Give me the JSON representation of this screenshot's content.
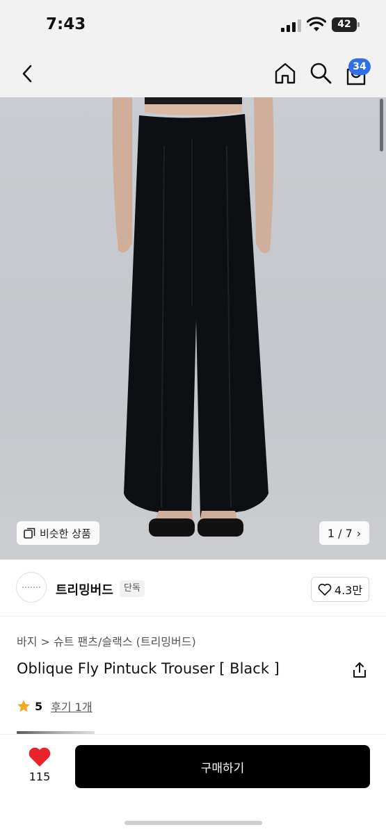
{
  "status_bar": {
    "time": "7:43",
    "battery": "42"
  },
  "nav": {
    "cart_count": "34",
    "icons": [
      "back-icon",
      "home-icon",
      "search-icon",
      "cart-icon"
    ]
  },
  "gallery": {
    "similar_label": "비슷한 상품",
    "page_indicator": "1 / 7",
    "page_chevron": "›"
  },
  "brand": {
    "name": "트리밍버드",
    "badge": "단독",
    "likes": "4.3만"
  },
  "product": {
    "breadcrumb": "바지 > 슈트 팬츠/슬랙스 (트리밍버드)",
    "title": "Oblique Fly Pintuck Trouser [ Black ]",
    "rating": "5",
    "review_label": "후기 1개"
  },
  "bottom_bar": {
    "wish_count": "115",
    "buy_label": "구매하기"
  },
  "colors": {
    "accent_badge": "#2f6fe8",
    "heart": "#e8232a",
    "star": "#f5a623",
    "buy_button": "#000000"
  }
}
